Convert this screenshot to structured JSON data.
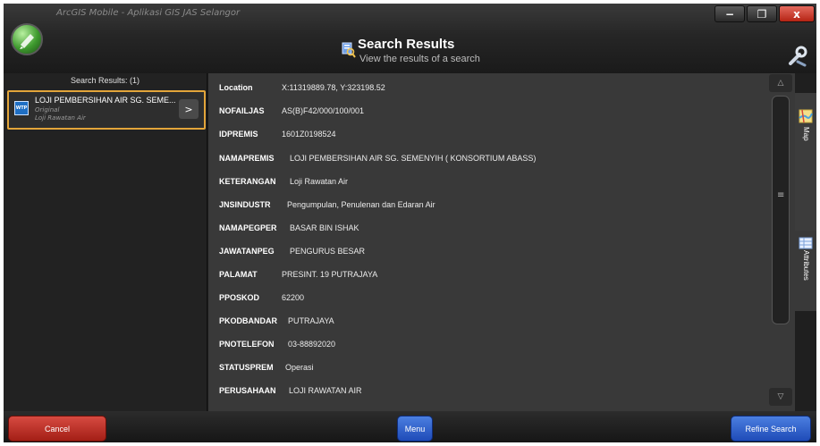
{
  "window": {
    "title": "ArcGIS Mobile - Aplikasi GIS JAS Selangor",
    "min_label": "−",
    "max_label": "❐",
    "close_label": "x"
  },
  "header": {
    "title": "Search Results",
    "subtitle": "View the results of a search",
    "icon": "search-results-icon",
    "settings_icon": "tools-icon"
  },
  "left_panel": {
    "heading": "Search Results: (1)",
    "results": [
      {
        "badge": "WTP",
        "title": "LOJI PEMBERSIHAN AIR SG. SEME...",
        "sub1": "Original",
        "sub2": "Loji Rawatan Air",
        "go_label": ">"
      }
    ]
  },
  "attributes": [
    {
      "label": "Location",
      "value": "X:11319889.78, Y:323198.52"
    },
    {
      "label": "NOFAILJAS",
      "value": "AS(B)F42/000/100/001"
    },
    {
      "label": "IDPREMIS",
      "value": "1601Z0198524"
    },
    {
      "label": "NAMAPREMIS",
      "value": "LOJI PEMBERSIHAN AIR SG. SEMENYIH ( KONSORTIUM ABASS)"
    },
    {
      "label": "KETERANGAN",
      "value": "Loji Rawatan Air"
    },
    {
      "label": "JNSINDUSTR",
      "value": "Pengumpulan, Penulenan dan Edaran Air"
    },
    {
      "label": "NAMAPEGPER",
      "value": "BASAR BIN ISHAK"
    },
    {
      "label": "JAWATANPEG",
      "value": "PENGURUS BESAR"
    },
    {
      "label": "PALAMAT",
      "value": "PRESINT. 19 PUTRAJAYA"
    },
    {
      "label": "PPOSKOD",
      "value": "62200"
    },
    {
      "label": "PKODBANDAR",
      "value": "PUTRAJAYA"
    },
    {
      "label": "PNOTELEFON",
      "value": "03-88892020"
    },
    {
      "label": "STATUSPREM",
      "value": "Operasi"
    },
    {
      "label": "PERUSAHAAN",
      "value": "LOJI RAWATAN AIR"
    }
  ],
  "scrollbar": {
    "up_label": "△",
    "down_label": "▽",
    "grip_label": "≡"
  },
  "right_tabs": [
    {
      "label": "Map",
      "icon": "map-icon"
    },
    {
      "label": "Attributes",
      "icon": "attributes-table-icon"
    }
  ],
  "bottom": {
    "cancel_label": "Cancel",
    "menu_label": "Menu",
    "refine_label": "Refine Search"
  },
  "colors": {
    "selection_border": "#e3a53a",
    "cancel": "#c2352b",
    "primary_blue": "#2f5fd0"
  }
}
